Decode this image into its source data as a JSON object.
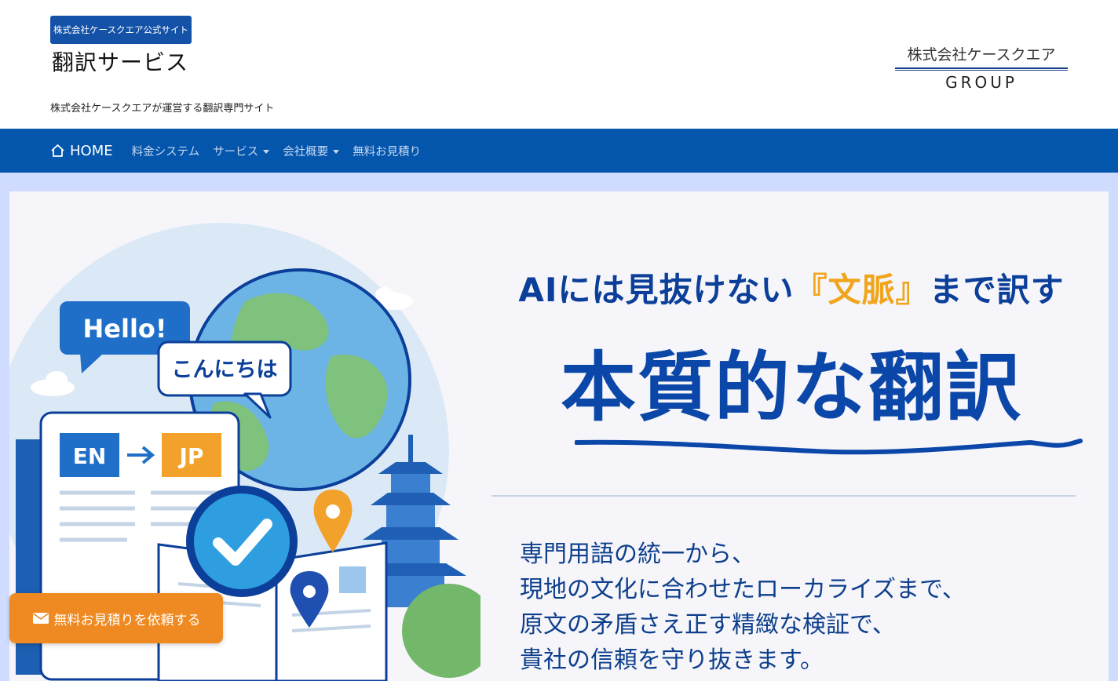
{
  "header": {
    "official_badge": "株式会社ケースクエア公式サイト",
    "site_title": "翻訳サービス",
    "tagline": "株式会社ケースクエアが運営する翻訳専門サイト",
    "group_logo": {
      "name": "株式会社ケースクエア",
      "sub": "GROUP"
    }
  },
  "nav": {
    "home": "HOME",
    "items": [
      {
        "label": "料金システム",
        "dropdown": false
      },
      {
        "label": "サービス",
        "dropdown": true
      },
      {
        "label": "会社概要",
        "dropdown": true
      },
      {
        "label": "無料お見積り",
        "dropdown": false
      }
    ]
  },
  "hero": {
    "headline_pre": "AIには見抜けない",
    "headline_accent": "『文脈』",
    "headline_post": "まで訳す",
    "main_title": "本質的な翻訳",
    "body_lines": [
      "専門用語の統一から、",
      "現地の文化に合わせたローカライズまで、",
      "原文の矛盾さえ正す精緻な検証で、",
      "貴社の信頼を守り抜きます。"
    ],
    "illustration": {
      "bubble_en": "Hello!",
      "bubble_jp": "こんにちは",
      "lang_from": "EN",
      "lang_to": "JP"
    }
  },
  "cta": {
    "label": "無料お見積りを依頼する"
  },
  "colors": {
    "brand_blue": "#0456ad",
    "title_blue": "#0b47a8",
    "accent_gold": "#f0a51c",
    "cta_orange": "#ef8a22",
    "hero_bg": "#cfdcff"
  }
}
